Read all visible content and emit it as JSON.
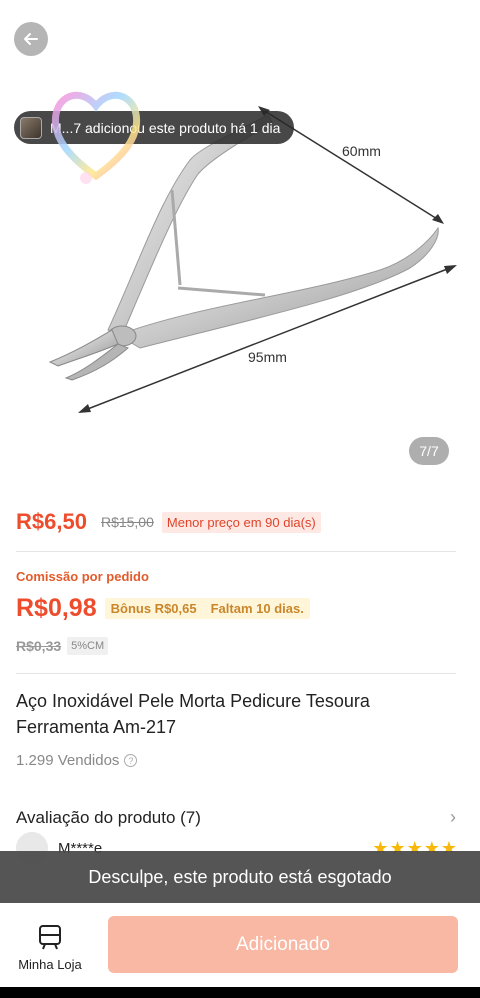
{
  "image": {
    "toast_text": "M...7 adicionou este produto há 1 dia",
    "dim_top": "60mm",
    "dim_bottom": "95mm",
    "counter": "7/7"
  },
  "price": {
    "current": "R$6,50",
    "original": "R$15,00",
    "badge": "Menor preço em 90 dia(s)"
  },
  "commission": {
    "label": "Comissão por pedido",
    "amount": "R$0,98",
    "bonus": "Bônus R$0,65",
    "remaining": "Faltam 10 dias.",
    "old_amount": "R$0,33",
    "cm": "5%CM"
  },
  "product": {
    "title": "Aço Inoxidável Pele Morta Pedicure Tesoura Ferramenta Am-217",
    "sold": "1.299 Vendidos",
    "help_glyph": "?"
  },
  "reviews": {
    "header": "Avaliação do produto (7)",
    "reviewer": "M****e",
    "rating": 5,
    "stars": "★★★★★"
  },
  "notice": "Desculpe, este produto está esgotado",
  "bottom": {
    "store_label": "Minha Loja",
    "add_label": "Adicionado"
  },
  "colors": {
    "accent": "#ee4d2d",
    "button_disabled": "#f8b8a4",
    "bonus_text": "#c9862a",
    "star": "#f6b80a"
  }
}
